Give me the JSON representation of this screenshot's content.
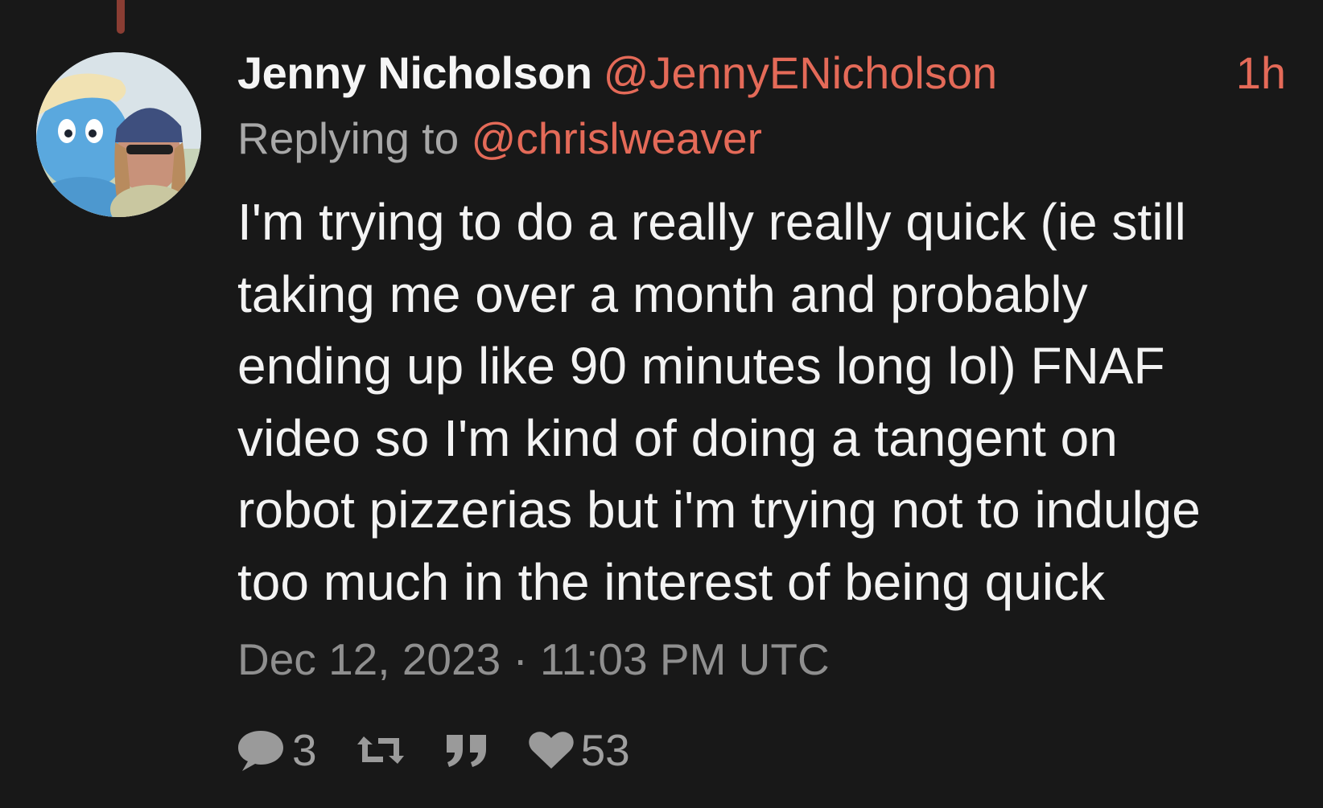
{
  "tweet": {
    "author_name": "Jenny Nicholson",
    "author_handle": "@JennyENicholson",
    "relative_time": "1h",
    "reply_prefix": "Replying to",
    "reply_handle": "@chrislweaver",
    "text": "I'm trying to do a really really quick (ie still\ntaking me over a month and probably\nending up like 90 minutes long lol) FNAF\nvideo so I'm kind of doing a tangent on\nrobot pizzerias but i'm trying not to indulge\ntoo much in the interest of being quick",
    "date": "Dec 12, 2023 · 11:03 PM UTC",
    "stats": {
      "replies": "3",
      "likes": "53"
    }
  },
  "icons": {
    "reply": "comment-icon",
    "retweet": "retweet-icon",
    "quote": "quote-icon",
    "like": "heart-icon"
  },
  "colors": {
    "background": "#181818",
    "accent": "#e46a58",
    "muted_text": "#8f8f8f",
    "primary_text": "#f3f3f3"
  }
}
